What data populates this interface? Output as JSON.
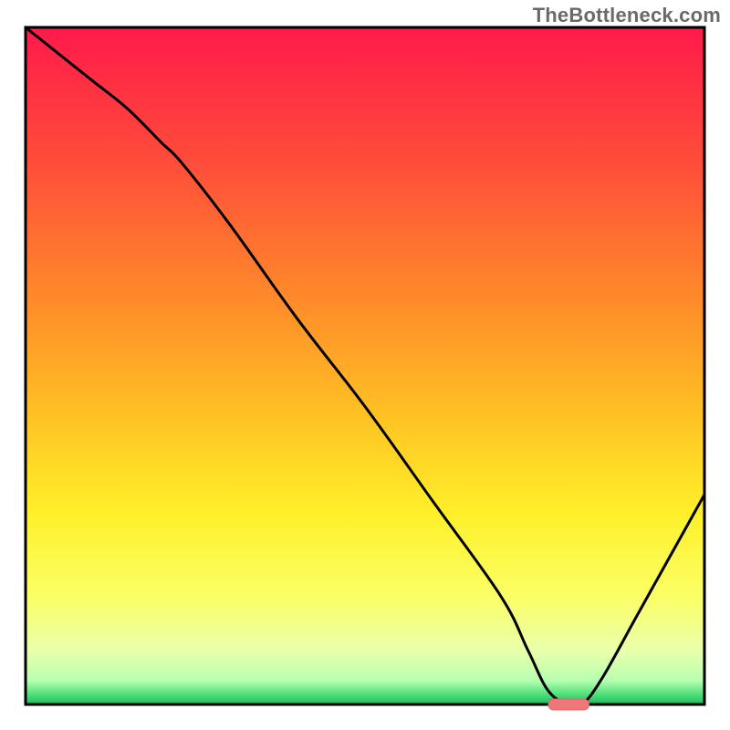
{
  "watermark": "TheBottleneck.com",
  "colors": {
    "curve_stroke": "#000000",
    "axis_stroke": "#000000",
    "marker_fill": "#ee7777",
    "marker_stroke": "#e46464"
  },
  "chart_data": {
    "type": "line",
    "title": "",
    "xlabel": "",
    "ylabel": "",
    "xlim": [
      0,
      100
    ],
    "ylim": [
      0,
      100
    ],
    "grid": false,
    "legend": false,
    "description": "Single black V-shaped curve over a vertical red→yellow→green gradient background. Minimum of the curve sits near x≈79. A small horizontal salmon-colored capsule marks the flat minimum region on the x-axis.",
    "x": [
      0,
      5,
      10,
      15,
      20,
      23,
      30,
      40,
      50,
      60,
      70,
      74,
      77,
      80,
      82,
      85,
      90,
      95,
      100
    ],
    "values": [
      100,
      96,
      92,
      88,
      83,
      80,
      71,
      57,
      44,
      30,
      16,
      8,
      2,
      0,
      0,
      4,
      13,
      22,
      31
    ],
    "marker_range": {
      "x_start": 77,
      "x_end": 83,
      "y": 0
    },
    "background_gradient_stops": [
      {
        "offset": 0.0,
        "color": "#ff1a4a"
      },
      {
        "offset": 0.2,
        "color": "#ff4d3a"
      },
      {
        "offset": 0.4,
        "color": "#ff8a2a"
      },
      {
        "offset": 0.58,
        "color": "#ffc423"
      },
      {
        "offset": 0.72,
        "color": "#fff02a"
      },
      {
        "offset": 0.84,
        "color": "#fbff66"
      },
      {
        "offset": 0.92,
        "color": "#eaffab"
      },
      {
        "offset": 0.965,
        "color": "#b6ffb0"
      },
      {
        "offset": 0.985,
        "color": "#4fe07a"
      },
      {
        "offset": 1.0,
        "color": "#1fb85f"
      }
    ]
  }
}
